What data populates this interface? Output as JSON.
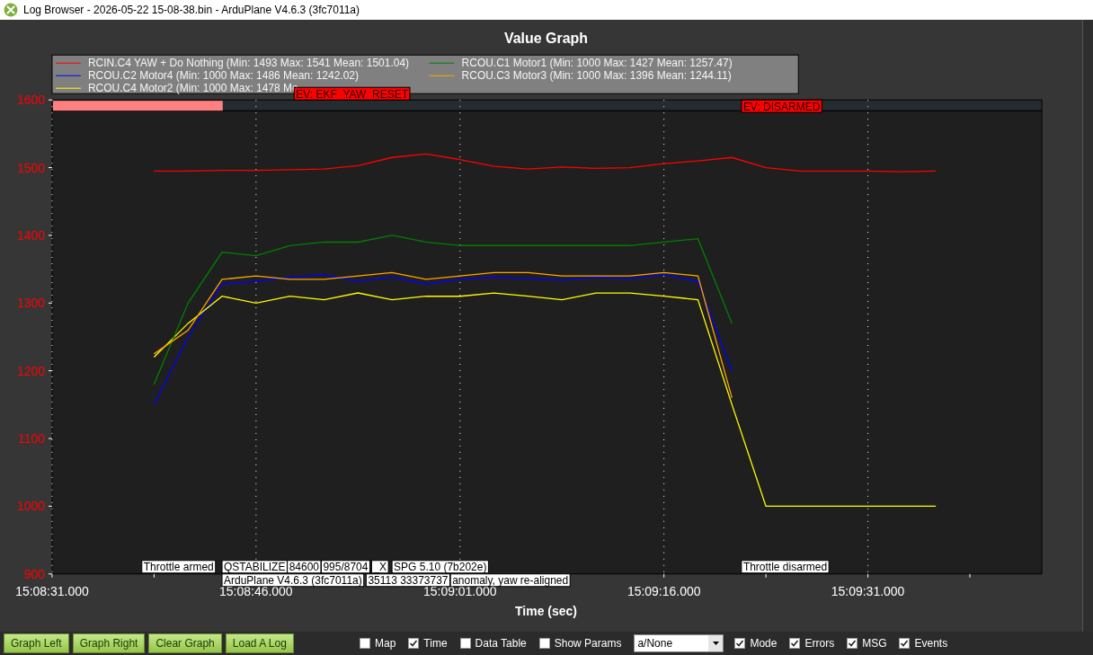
{
  "window": {
    "title": "Log Browser - 2026-05-22 15-08-38.bin - ArduPlane V4.6.3 (3fc7011a)"
  },
  "graph": {
    "legend": [
      {
        "stats": "(Min: 1493 Max: 1541 Mean: 1501.04)"
      },
      {
        "stats": "(Min: 1000 Max: 1486 Mean: 1242.02)"
      },
      {
        "stats": "(Min: 1000 Max: 1478 Me"
      },
      {
        "stats": "(Min: 1000 Max: 1427 Mean: 1257.47)"
      },
      {
        "stats": "(Min: 1000 Max: 1396 Mean: 1244.11)"
      }
    ],
    "chart_data": {
      "type": "line",
      "title": "Value Graph",
      "xlabel": "Time (sec)",
      "grid": true,
      "categories": [
        "15:08:31.000",
        null,
        null,
        null,
        null,
        null,
        "15:08:46.000",
        null,
        null,
        null,
        null,
        null,
        "15:09:01.000",
        null,
        null,
        null,
        null,
        null,
        "15:09:16.000",
        null,
        null,
        null,
        null,
        null,
        "15:09:31.000",
        null,
        null,
        null,
        null,
        null
      ],
      "ylim": [
        900,
        1600
      ],
      "yticks": [
        900,
        1000,
        1100,
        1200,
        1300,
        1400,
        1500,
        1600
      ],
      "series": [
        {
          "name": "RCIN.C4 YAW + Do Nothing",
          "color": "#ff0000",
          "values": [
            null,
            null,
            null,
            1495,
            1495,
            1496,
            1496,
            1497,
            1498,
            1503,
            1515,
            1520,
            1512,
            1502,
            1498,
            1501,
            1499,
            1500,
            1506,
            1510,
            1515,
            1500,
            1495,
            1495,
            1495,
            1494,
            1495,
            null,
            null,
            null
          ]
        },
        {
          "name": "RCOU.C2 Motor4",
          "color": "#0000ff",
          "values": [
            null,
            null,
            null,
            1150,
            1250,
            1328,
            1332,
            1338,
            1342,
            1332,
            1338,
            1328,
            1335,
            1338,
            1336,
            1334,
            1338,
            1336,
            1342,
            1332,
            1200,
            null,
            null,
            null,
            null,
            null,
            null,
            null,
            null,
            null
          ]
        },
        {
          "name": "RCOU.C4 Motor2",
          "color": "#ffff00",
          "values": [
            null,
            null,
            null,
            1220,
            1270,
            1310,
            1300,
            1310,
            1305,
            1315,
            1305,
            1310,
            1310,
            1315,
            1310,
            1305,
            1315,
            1315,
            1310,
            1305,
            1150,
            1000,
            1000,
            1000,
            1000,
            1000,
            1000,
            null,
            null,
            null
          ]
        },
        {
          "name": "RCOU.C1 Motor1",
          "color": "#008000",
          "values": [
            null,
            null,
            null,
            1180,
            1300,
            1375,
            1370,
            1385,
            1390,
            1390,
            1400,
            1390,
            1385,
            1385,
            1385,
            1385,
            1385,
            1385,
            1390,
            1395,
            1270,
            null,
            null,
            null,
            null,
            null,
            null,
            null,
            null,
            null
          ]
        },
        {
          "name": "RCOU.C3 Motor3",
          "color": "#ffa500",
          "values": [
            null,
            null,
            null,
            1225,
            1260,
            1335,
            1340,
            1335,
            1335,
            1340,
            1345,
            1335,
            1340,
            1345,
            1345,
            1340,
            1340,
            1340,
            1345,
            1340,
            1160,
            null,
            null,
            null,
            null,
            null,
            null,
            null,
            null,
            null
          ]
        }
      ]
    },
    "events": [
      {
        "text": "EV: EKF_YAW_RESET"
      },
      {
        "text": "EV: DISARMED"
      }
    ],
    "messages": [
      {
        "text": "Throttle armed"
      },
      {
        "text": "QSTABILIZE"
      },
      {
        "text": "84600"
      },
      {
        "text": "995/8704"
      },
      {
        "text": "_X"
      },
      {
        "text": "SPG 5.10 (7b202e)"
      },
      {
        "text": "Throttle disarmed"
      },
      {
        "text": "ArduPlane V4.6.3 (3fc7011a)"
      },
      {
        "text": "35113 33373737"
      },
      {
        "text": "anomaly, yaw re-aligned"
      }
    ]
  },
  "toolbar": {
    "buttons": [
      "Graph Left",
      "Graph Right",
      "Clear Graph",
      "Load A Log"
    ],
    "controls": [
      {
        "kind": "checkbox",
        "label": "Map",
        "checked": false
      },
      {
        "kind": "checkbox",
        "label": "Time",
        "checked": true
      },
      {
        "kind": "checkbox",
        "label": "Data Table",
        "checked": false
      },
      {
        "kind": "checkbox",
        "label": "Show Params",
        "checked": false
      },
      {
        "kind": "dropdown",
        "value": "a/None"
      },
      {
        "kind": "checkbox",
        "label": "Mode",
        "checked": true
      },
      {
        "kind": "checkbox",
        "label": "Errors",
        "checked": true
      },
      {
        "kind": "checkbox",
        "label": "MSG",
        "checked": true
      },
      {
        "kind": "checkbox",
        "label": "Events",
        "checked": true
      }
    ]
  }
}
